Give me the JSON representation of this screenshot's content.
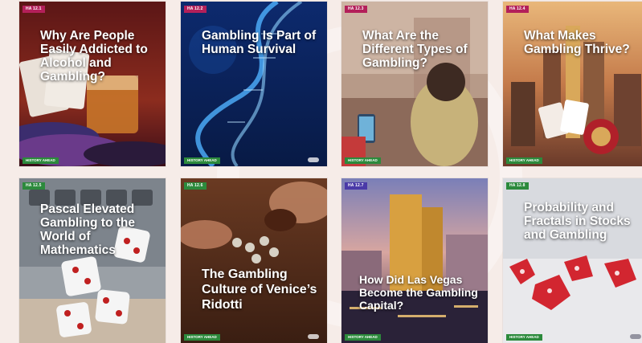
{
  "cards": [
    {
      "tag": "HA 12.1",
      "title": "Why Are People Easily Addicted to Alcohol and Gambling?",
      "footer": "HISTORY AHEAD",
      "tag_color": "#b3205a"
    },
    {
      "tag": "HA 12.2",
      "title": "Gambling Is Part of Human Survival",
      "footer": "HISTORY AHEAD",
      "tag_color": "#b3205a"
    },
    {
      "tag": "HA 12.3",
      "title": "What Are the Different Types of Gambling?",
      "footer": "HISTORY AHEAD",
      "tag_color": "#b3205a"
    },
    {
      "tag": "HA 12.4",
      "title": "What Makes Gambling Thrive?",
      "footer": "HISTORY AHEAD",
      "tag_color": "#b3205a"
    },
    {
      "tag": "HA 12.5",
      "title": "Pascal Elevated Gambling to the World of Mathematics",
      "footer": "HISTORY AHEAD",
      "tag_color": "#2c8a3c"
    },
    {
      "tag": "HA 12.6",
      "title": "The Gambling Culture of Venice’s Ridotti",
      "footer": "HISTORY AHEAD",
      "tag_color": "#2c8a3c"
    },
    {
      "tag": "HA 12.7",
      "title": "How Did Las Vegas Become the Gambling Capital?",
      "footer": "HISTORY AHEAD",
      "tag_color": "#4a3aa8"
    },
    {
      "tag": "HA 12.8",
      "title": "Probability and Fractals in Stocks and Gambling",
      "footer": "HISTORY AHEAD",
      "tag_color": "#2c8a3c"
    }
  ]
}
